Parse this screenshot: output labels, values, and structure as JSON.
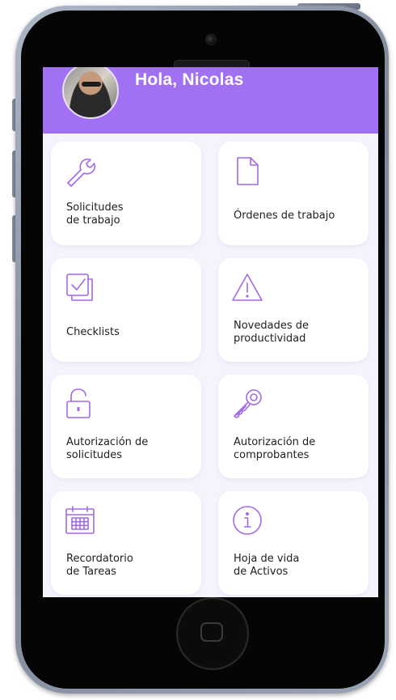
{
  "header": {
    "greeting": "Hola, Nicolas",
    "background_color": "#a071f2"
  },
  "accent_color": "#a26ae6",
  "menu": {
    "items": [
      {
        "label": "Solicitudes\nde trabajo",
        "icon": "wrench-icon"
      },
      {
        "label": "Órdenes de trabajo",
        "icon": "document-icon"
      },
      {
        "label": "Checklists",
        "icon": "checklist-icon"
      },
      {
        "label": "Novedades de\nproductividad",
        "icon": "warning-icon"
      },
      {
        "label": "Autorización de\nsolicitudes",
        "icon": "padlock-icon"
      },
      {
        "label": "Autorización de\ncomprobantes",
        "icon": "key-icon"
      },
      {
        "label": "Recordatorio\nde Tareas",
        "icon": "calendar-icon"
      },
      {
        "label": "Hoja de vida\nde Activos",
        "icon": "info-icon"
      }
    ]
  }
}
